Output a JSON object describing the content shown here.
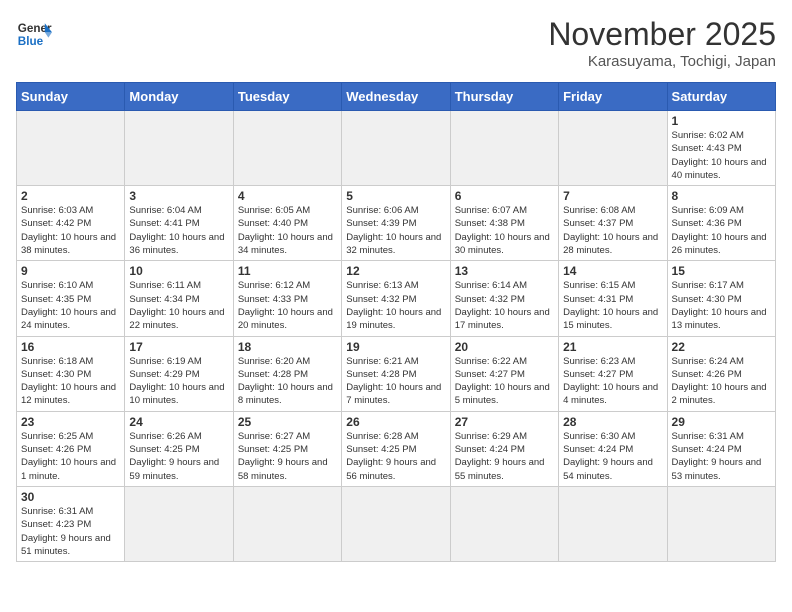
{
  "logo": {
    "text_general": "General",
    "text_blue": "Blue"
  },
  "title": "November 2025",
  "subtitle": "Karasuyama, Tochigi, Japan",
  "weekdays": [
    "Sunday",
    "Monday",
    "Tuesday",
    "Wednesday",
    "Thursday",
    "Friday",
    "Saturday"
  ],
  "weeks": [
    [
      {
        "day": "",
        "empty": true
      },
      {
        "day": "",
        "empty": true
      },
      {
        "day": "",
        "empty": true
      },
      {
        "day": "",
        "empty": true
      },
      {
        "day": "",
        "empty": true
      },
      {
        "day": "",
        "empty": true
      },
      {
        "day": "1",
        "sunrise": "6:02 AM",
        "sunset": "4:43 PM",
        "daylight": "10 hours and 40 minutes."
      }
    ],
    [
      {
        "day": "2",
        "sunrise": "6:03 AM",
        "sunset": "4:42 PM",
        "daylight": "10 hours and 38 minutes."
      },
      {
        "day": "3",
        "sunrise": "6:04 AM",
        "sunset": "4:41 PM",
        "daylight": "10 hours and 36 minutes."
      },
      {
        "day": "4",
        "sunrise": "6:05 AM",
        "sunset": "4:40 PM",
        "daylight": "10 hours and 34 minutes."
      },
      {
        "day": "5",
        "sunrise": "6:06 AM",
        "sunset": "4:39 PM",
        "daylight": "10 hours and 32 minutes."
      },
      {
        "day": "6",
        "sunrise": "6:07 AM",
        "sunset": "4:38 PM",
        "daylight": "10 hours and 30 minutes."
      },
      {
        "day": "7",
        "sunrise": "6:08 AM",
        "sunset": "4:37 PM",
        "daylight": "10 hours and 28 minutes."
      },
      {
        "day": "8",
        "sunrise": "6:09 AM",
        "sunset": "4:36 PM",
        "daylight": "10 hours and 26 minutes."
      }
    ],
    [
      {
        "day": "9",
        "sunrise": "6:10 AM",
        "sunset": "4:35 PM",
        "daylight": "10 hours and 24 minutes."
      },
      {
        "day": "10",
        "sunrise": "6:11 AM",
        "sunset": "4:34 PM",
        "daylight": "10 hours and 22 minutes."
      },
      {
        "day": "11",
        "sunrise": "6:12 AM",
        "sunset": "4:33 PM",
        "daylight": "10 hours and 20 minutes."
      },
      {
        "day": "12",
        "sunrise": "6:13 AM",
        "sunset": "4:32 PM",
        "daylight": "10 hours and 19 minutes."
      },
      {
        "day": "13",
        "sunrise": "6:14 AM",
        "sunset": "4:32 PM",
        "daylight": "10 hours and 17 minutes."
      },
      {
        "day": "14",
        "sunrise": "6:15 AM",
        "sunset": "4:31 PM",
        "daylight": "10 hours and 15 minutes."
      },
      {
        "day": "15",
        "sunrise": "6:17 AM",
        "sunset": "4:30 PM",
        "daylight": "10 hours and 13 minutes."
      }
    ],
    [
      {
        "day": "16",
        "sunrise": "6:18 AM",
        "sunset": "4:30 PM",
        "daylight": "10 hours and 12 minutes."
      },
      {
        "day": "17",
        "sunrise": "6:19 AM",
        "sunset": "4:29 PM",
        "daylight": "10 hours and 10 minutes."
      },
      {
        "day": "18",
        "sunrise": "6:20 AM",
        "sunset": "4:28 PM",
        "daylight": "10 hours and 8 minutes."
      },
      {
        "day": "19",
        "sunrise": "6:21 AM",
        "sunset": "4:28 PM",
        "daylight": "10 hours and 7 minutes."
      },
      {
        "day": "20",
        "sunrise": "6:22 AM",
        "sunset": "4:27 PM",
        "daylight": "10 hours and 5 minutes."
      },
      {
        "day": "21",
        "sunrise": "6:23 AM",
        "sunset": "4:27 PM",
        "daylight": "10 hours and 4 minutes."
      },
      {
        "day": "22",
        "sunrise": "6:24 AM",
        "sunset": "4:26 PM",
        "daylight": "10 hours and 2 minutes."
      }
    ],
    [
      {
        "day": "23",
        "sunrise": "6:25 AM",
        "sunset": "4:26 PM",
        "daylight": "10 hours and 1 minute."
      },
      {
        "day": "24",
        "sunrise": "6:26 AM",
        "sunset": "4:25 PM",
        "daylight": "9 hours and 59 minutes."
      },
      {
        "day": "25",
        "sunrise": "6:27 AM",
        "sunset": "4:25 PM",
        "daylight": "9 hours and 58 minutes."
      },
      {
        "day": "26",
        "sunrise": "6:28 AM",
        "sunset": "4:25 PM",
        "daylight": "9 hours and 56 minutes."
      },
      {
        "day": "27",
        "sunrise": "6:29 AM",
        "sunset": "4:24 PM",
        "daylight": "9 hours and 55 minutes."
      },
      {
        "day": "28",
        "sunrise": "6:30 AM",
        "sunset": "4:24 PM",
        "daylight": "9 hours and 54 minutes."
      },
      {
        "day": "29",
        "sunrise": "6:31 AM",
        "sunset": "4:24 PM",
        "daylight": "9 hours and 53 minutes."
      }
    ],
    [
      {
        "day": "30",
        "sunrise": "6:31 AM",
        "sunset": "4:23 PM",
        "daylight": "9 hours and 51 minutes."
      },
      {
        "day": "",
        "empty": true
      },
      {
        "day": "",
        "empty": true
      },
      {
        "day": "",
        "empty": true
      },
      {
        "day": "",
        "empty": true
      },
      {
        "day": "",
        "empty": true
      },
      {
        "day": "",
        "empty": true
      }
    ]
  ]
}
